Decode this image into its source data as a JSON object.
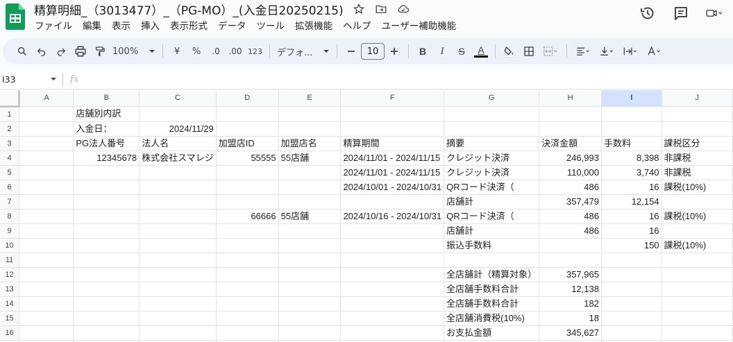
{
  "app": {
    "doc_title": "精算明細_（3013477）_（PG-MO）_(入金日20250215)",
    "menu": [
      "ファイル",
      "編集",
      "表示",
      "挿入",
      "表示形式",
      "データ",
      "ツール",
      "拡張機能",
      "ヘルプ",
      "ユーザー補助機能"
    ]
  },
  "toolbar": {
    "zoom": "100%",
    "currency": "¥",
    "percent": "%",
    "dec_decrease": ".0",
    "dec_increase": ".00",
    "number_format": "123",
    "font": "デフォ...",
    "font_size": "10",
    "bold": "B",
    "italic": "I",
    "strike": "S",
    "text_color": "A",
    "text_color_value": "#000000"
  },
  "formula_bar": {
    "cell_ref": "I33",
    "fx": "fx",
    "value": ""
  },
  "columns": [
    "A",
    "B",
    "C",
    "D",
    "E",
    "F",
    "G",
    "H",
    "I",
    "J"
  ],
  "selected_column": "I",
  "rows": [
    {
      "n": "1",
      "cells": [
        "",
        "店舗別内訳",
        "",
        "",
        "",
        "",
        "",
        "",
        "",
        ""
      ]
    },
    {
      "n": "2",
      "cells": [
        "",
        "入金日：",
        "2024/11/29",
        "",
        "",
        "",
        "",
        "",
        "",
        ""
      ]
    },
    {
      "n": "3",
      "cells": [
        "",
        "PG法人番号",
        "法人名",
        "加盟店ID",
        "加盟店名",
        "精算期間",
        "摘要",
        "決済金額",
        "手数料",
        "課税区分"
      ]
    },
    {
      "n": "4",
      "cells": [
        "",
        "12345678",
        "株式会社スマレジ",
        "55555",
        "55店舗",
        "2024/11/01 - 2024/11/15",
        "クレジット決済",
        "246,993",
        "8,398",
        "非課税"
      ]
    },
    {
      "n": "5",
      "cells": [
        "",
        "",
        "",
        "",
        "",
        "2024/11/01 - 2024/11/15",
        "クレジット決済",
        "110,000",
        "3,740",
        "非課税"
      ]
    },
    {
      "n": "6",
      "cells": [
        "",
        "",
        "",
        "",
        "",
        "2024/10/01 - 2024/10/31",
        "QRコード決済（",
        "486",
        "16",
        "課税(10%)"
      ]
    },
    {
      "n": "7",
      "cells": [
        "",
        "",
        "",
        "",
        "",
        "",
        "店舗計",
        "357,479",
        "12,154",
        ""
      ]
    },
    {
      "n": "8",
      "cells": [
        "",
        "",
        "",
        "66666",
        "55店舗",
        "2024/10/16 - 2024/10/31",
        "QRコード決済（",
        "486",
        "16",
        "課税(10%)"
      ]
    },
    {
      "n": "9",
      "cells": [
        "",
        "",
        "",
        "",
        "",
        "",
        "店舗計",
        "486",
        "16",
        ""
      ]
    },
    {
      "n": "10",
      "cells": [
        "",
        "",
        "",
        "",
        "",
        "",
        "振込手数料",
        "",
        "150",
        "課税(10%)"
      ]
    },
    {
      "n": "11",
      "cells": [
        "",
        "",
        "",
        "",
        "",
        "",
        "",
        "",
        "",
        ""
      ]
    },
    {
      "n": "12",
      "cells": [
        "",
        "",
        "",
        "",
        "",
        "",
        "全店舗計（精算対象）",
        "357,965",
        "",
        ""
      ]
    },
    {
      "n": "13",
      "cells": [
        "",
        "",
        "",
        "",
        "",
        "",
        "全店舗手数料合計",
        "12,138",
        "",
        ""
      ]
    },
    {
      "n": "14",
      "cells": [
        "",
        "",
        "",
        "",
        "",
        "",
        "全店舗手数料合計",
        "182",
        "",
        ""
      ]
    },
    {
      "n": "15",
      "cells": [
        "",
        "",
        "",
        "",
        "",
        "",
        "全店舗消費税(10%)",
        "18",
        "",
        ""
      ]
    },
    {
      "n": "16",
      "cells": [
        "",
        "",
        "",
        "",
        "",
        "",
        "お支払金額",
        "345,627",
        "",
        ""
      ]
    },
    {
      "n": "17",
      "cells": [
        "",
        "",
        "",
        "",
        "",
        "",
        "",
        "",
        "",
        ""
      ]
    }
  ],
  "colors": {
    "accent": "#0b57d0",
    "sheets_green": "#0f9d58",
    "toolbar_bg": "#edf2fa",
    "selected_header": "#d3e3fd"
  }
}
